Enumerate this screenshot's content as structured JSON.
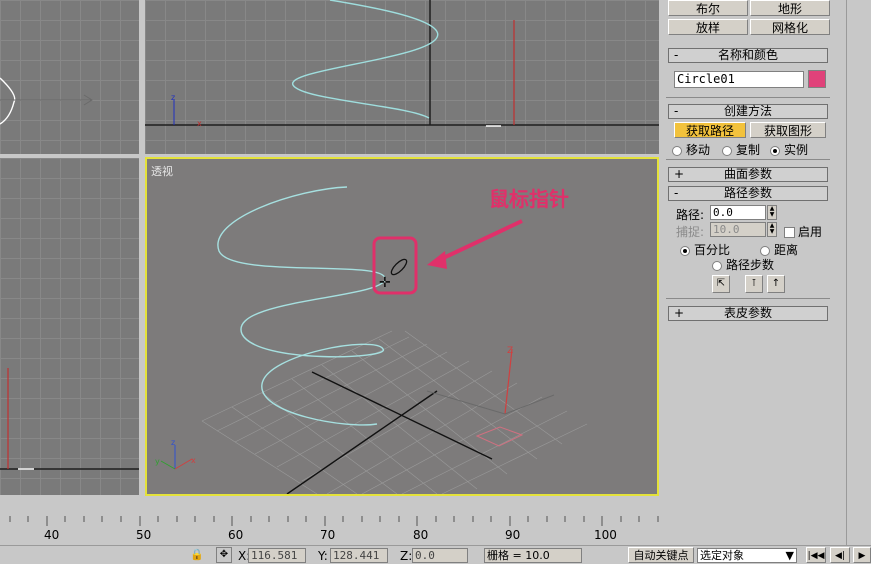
{
  "top_buttons": [
    {
      "label": "布尔"
    },
    {
      "label": "地形"
    },
    {
      "label": "放样"
    },
    {
      "label": "网格化"
    }
  ],
  "name_color": {
    "header": "名称和颜色",
    "object_name": "Circle01",
    "color": "#e0427a"
  },
  "creation_method": {
    "header": "创建方法",
    "get_path": "获取路径",
    "get_shape": "获取图形",
    "move": "移动",
    "copy": "复制",
    "instance": "实例"
  },
  "surface_params": {
    "header": "曲面参数"
  },
  "path_params": {
    "header": "路径参数",
    "path_label": "路径:",
    "path_value": "0.0",
    "snap_label": "捕捉:",
    "snap_value": "10.0",
    "enable": "启用",
    "percentage": "百分比",
    "distance": "距离",
    "path_steps": "路径步数"
  },
  "skin_params": {
    "header": "表皮参数"
  },
  "viewport": {
    "label": "透视"
  },
  "annotation": {
    "text": "鼠标指针",
    "color": "#e0306a"
  },
  "ruler": {
    "ticks": [
      "40",
      "50",
      "60",
      "70",
      "80",
      "90",
      "100"
    ]
  },
  "status": {
    "x_label": "X:",
    "x_value": "116.581",
    "y_label": "Y:",
    "y_value": "128.441",
    "z_label": "Z:",
    "z_value": "0.0",
    "grid": "栅格 = 10.0",
    "auto_key": "自动关键点",
    "selected": "选定对象"
  }
}
